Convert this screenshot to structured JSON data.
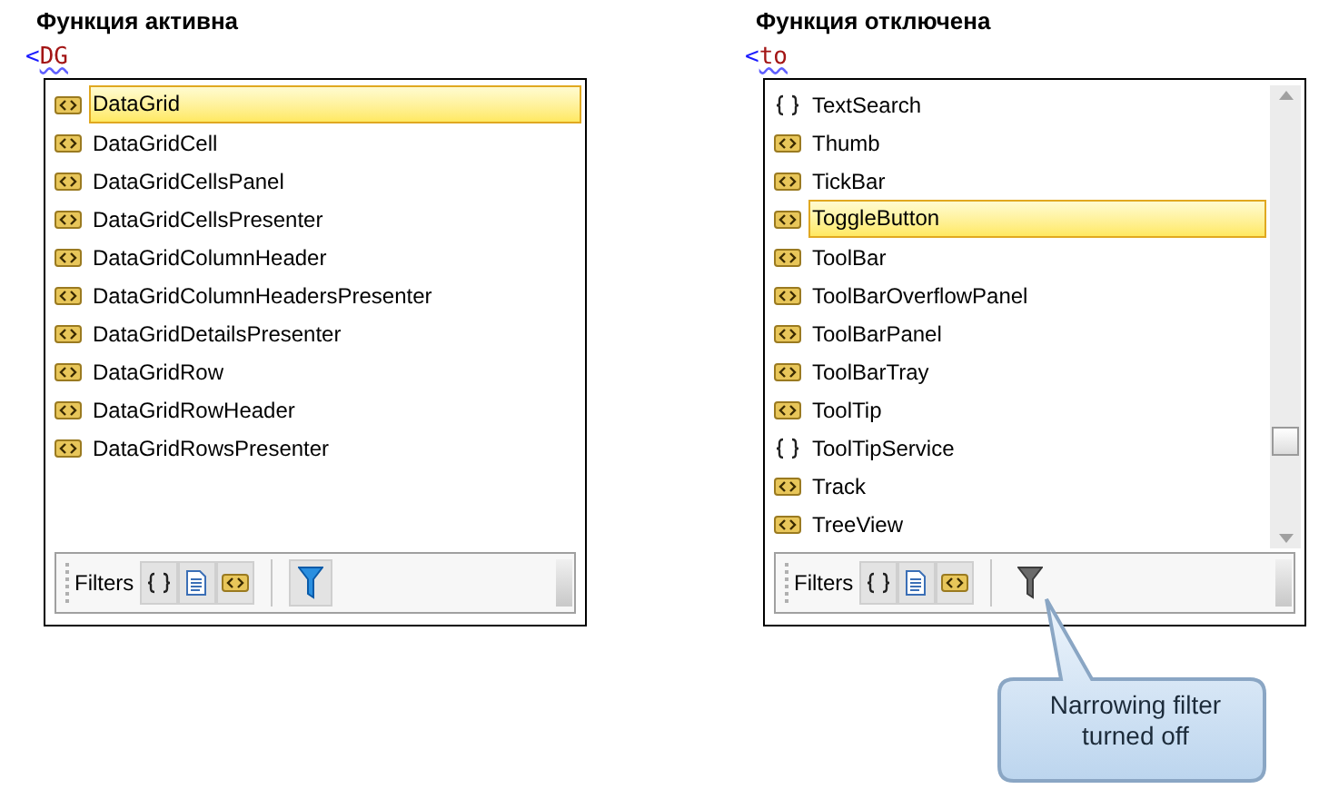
{
  "panels": [
    {
      "title": "Функция активна",
      "typed_prefix": "<",
      "typed": "DG",
      "scrollbar": false,
      "items": [
        {
          "label": "DataGrid",
          "kind": "element",
          "selected": true
        },
        {
          "label": "DataGridCell",
          "kind": "element",
          "selected": false
        },
        {
          "label": "DataGridCellsPanel",
          "kind": "element",
          "selected": false
        },
        {
          "label": "DataGridCellsPresenter",
          "kind": "element",
          "selected": false
        },
        {
          "label": "DataGridColumnHeader",
          "kind": "element",
          "selected": false
        },
        {
          "label": "DataGridColumnHeadersPresenter",
          "kind": "element",
          "selected": false
        },
        {
          "label": "DataGridDetailsPresenter",
          "kind": "element",
          "selected": false
        },
        {
          "label": "DataGridRow",
          "kind": "element",
          "selected": false
        },
        {
          "label": "DataGridRowHeader",
          "kind": "element",
          "selected": false
        },
        {
          "label": "DataGridRowsPresenter",
          "kind": "element",
          "selected": false
        }
      ],
      "filters": {
        "label": "Filters",
        "buttons": [
          {
            "kind": "namespace",
            "selected": true
          },
          {
            "kind": "document",
            "selected": true
          },
          {
            "kind": "element",
            "selected": true
          }
        ],
        "narrowing": true
      }
    },
    {
      "title": "Функция отключена",
      "typed_prefix": "<",
      "typed": "to",
      "scrollbar": true,
      "items": [
        {
          "label": "TextSearch",
          "kind": "namespace",
          "selected": false
        },
        {
          "label": "Thumb",
          "kind": "element",
          "selected": false
        },
        {
          "label": "TickBar",
          "kind": "element",
          "selected": false
        },
        {
          "label": "ToggleButton",
          "kind": "element",
          "selected": true
        },
        {
          "label": "ToolBar",
          "kind": "element",
          "selected": false
        },
        {
          "label": "ToolBarOverflowPanel",
          "kind": "element",
          "selected": false
        },
        {
          "label": "ToolBarPanel",
          "kind": "element",
          "selected": false
        },
        {
          "label": "ToolBarTray",
          "kind": "element",
          "selected": false
        },
        {
          "label": "ToolTip",
          "kind": "element",
          "selected": false
        },
        {
          "label": "ToolTipService",
          "kind": "namespace",
          "selected": false
        },
        {
          "label": "Track",
          "kind": "element",
          "selected": false
        },
        {
          "label": "TreeView",
          "kind": "element",
          "selected": false
        }
      ],
      "filters": {
        "label": "Filters",
        "buttons": [
          {
            "kind": "namespace",
            "selected": true
          },
          {
            "kind": "document",
            "selected": true
          },
          {
            "kind": "element",
            "selected": true
          }
        ],
        "narrowing": false
      }
    }
  ],
  "callout": {
    "text": "Narrowing filter turned off"
  }
}
